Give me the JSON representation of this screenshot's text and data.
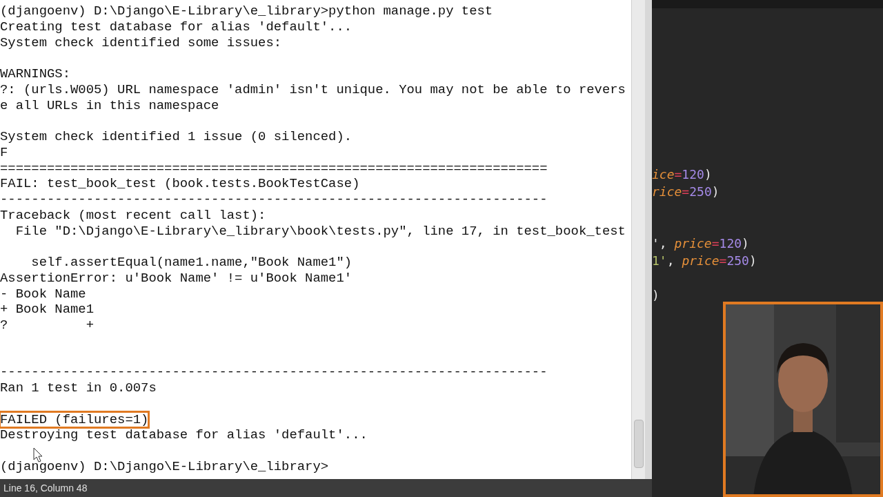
{
  "terminal": {
    "lines": [
      {
        "kind": "text",
        "text": "(djangoenv) D:\\Django\\E-Library\\e_library>python manage.py test",
        "highlighted": false
      },
      {
        "kind": "text",
        "text": "Creating test database for alias 'default'...",
        "highlighted": false
      },
      {
        "kind": "text",
        "text": "System check identified some issues:",
        "highlighted": false
      },
      {
        "kind": "blank"
      },
      {
        "kind": "text",
        "text": "WARNINGS:",
        "highlighted": false
      },
      {
        "kind": "text",
        "text": "?: (urls.W005) URL namespace 'admin' isn't unique. You may not be able to revers",
        "highlighted": false
      },
      {
        "kind": "text",
        "text": "e all URLs in this namespace",
        "highlighted": false
      },
      {
        "kind": "blank"
      },
      {
        "kind": "text",
        "text": "System check identified 1 issue (0 silenced).",
        "highlighted": false
      },
      {
        "kind": "text",
        "text": "F",
        "highlighted": false
      },
      {
        "kind": "text",
        "text": "======================================================================",
        "highlighted": false
      },
      {
        "kind": "text",
        "text": "FAIL: test_book_test (book.tests.BookTestCase)",
        "highlighted": false
      },
      {
        "kind": "text",
        "text": "----------------------------------------------------------------------",
        "highlighted": false
      },
      {
        "kind": "text",
        "text": "Traceback (most recent call last):",
        "highlighted": false
      },
      {
        "kind": "text",
        "text": "  File \"D:\\Django\\E-Library\\e_library\\book\\tests.py\", line 17, in test_book_test",
        "highlighted": false
      },
      {
        "kind": "blank"
      },
      {
        "kind": "text",
        "text": "    self.assertEqual(name1.name,\"Book Name1\")",
        "highlighted": false
      },
      {
        "kind": "text",
        "text": "AssertionError: u'Book Name' != u'Book Name1'",
        "highlighted": false
      },
      {
        "kind": "text",
        "text": "- Book Name",
        "highlighted": false
      },
      {
        "kind": "text",
        "text": "+ Book Name1",
        "highlighted": false
      },
      {
        "kind": "text",
        "text": "?          +",
        "highlighted": false
      },
      {
        "kind": "blank"
      },
      {
        "kind": "blank"
      },
      {
        "kind": "text",
        "text": "----------------------------------------------------------------------",
        "highlighted": false
      },
      {
        "kind": "text",
        "text": "Ran 1 test in 0.007s",
        "highlighted": false
      },
      {
        "kind": "blank"
      },
      {
        "kind": "text",
        "text": "FAILED (failures=1)",
        "highlighted": true
      },
      {
        "kind": "text",
        "text": "Destroying test database for alias 'default'...",
        "highlighted": false
      },
      {
        "kind": "blank"
      },
      {
        "kind": "text",
        "text": "(djangoenv) D:\\Django\\E-Library\\e_library>",
        "highlighted": false
      }
    ]
  },
  "status_bar": {
    "text": "Line 16, Column 48"
  },
  "editor": {
    "lines": [
      {
        "kind": "code",
        "segments": [
          {
            "text": "ice",
            "kind": "keyword"
          },
          {
            "text": "=",
            "kind": "operator"
          },
          {
            "text": "120",
            "kind": "number"
          },
          {
            "text": ")",
            "kind": "punct"
          }
        ]
      },
      {
        "kind": "code",
        "segments": [
          {
            "text": "rice",
            "kind": "keyword"
          },
          {
            "text": "=",
            "kind": "operator"
          },
          {
            "text": "250",
            "kind": "number"
          },
          {
            "text": ")",
            "kind": "punct"
          }
        ]
      },
      {
        "kind": "blank"
      },
      {
        "kind": "blank"
      },
      {
        "kind": "code",
        "segments": [
          {
            "text": "', ",
            "kind": "punct"
          },
          {
            "text": "price",
            "kind": "keyword"
          },
          {
            "text": "=",
            "kind": "operator"
          },
          {
            "text": "120",
            "kind": "number"
          },
          {
            "text": ")",
            "kind": "punct"
          }
        ]
      },
      {
        "kind": "code",
        "segments": [
          {
            "text": "1'",
            "kind": "string"
          },
          {
            "text": ", ",
            "kind": "punct"
          },
          {
            "text": "price",
            "kind": "keyword"
          },
          {
            "text": "=",
            "kind": "operator"
          },
          {
            "text": "250",
            "kind": "number"
          },
          {
            "text": ")",
            "kind": "punct"
          }
        ]
      },
      {
        "kind": "blank"
      },
      {
        "kind": "code",
        "segments": [
          {
            "text": ")",
            "kind": "punct"
          }
        ]
      }
    ]
  }
}
